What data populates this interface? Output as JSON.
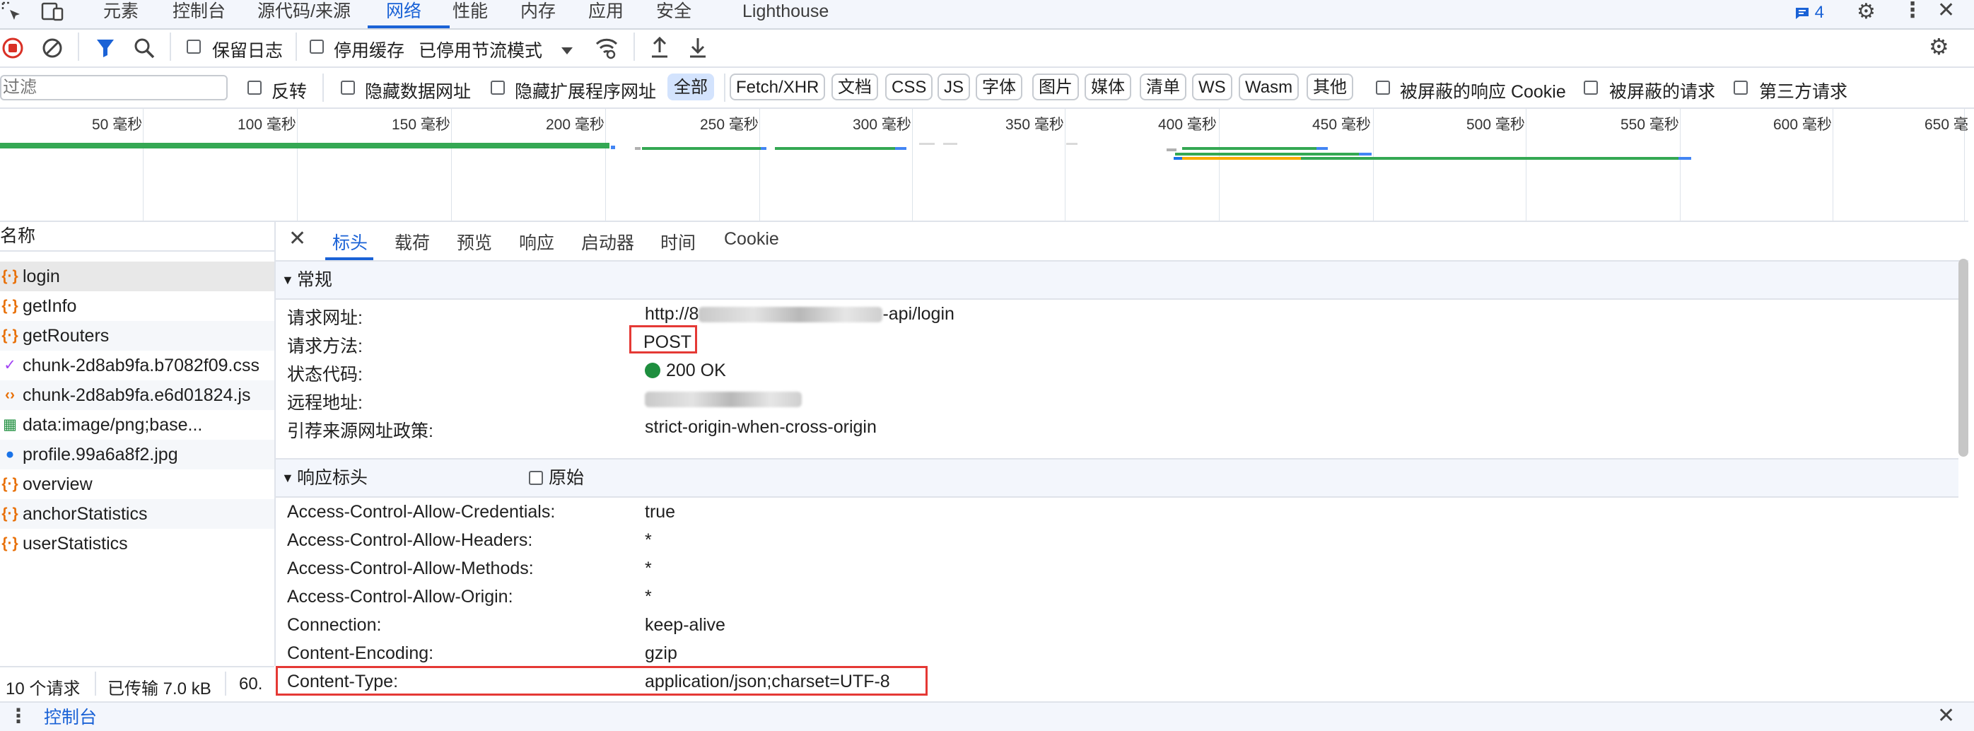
{
  "top_tabs": {
    "elements": "元素",
    "console": "控制台",
    "sources": "源代码/来源",
    "network": "网络",
    "performance": "性能",
    "memory": "内存",
    "application": "应用",
    "security": "安全",
    "lighthouse": "Lighthouse",
    "issues_count": "4"
  },
  "toolbar": {
    "preserve_log": "保留日志",
    "disable_cache": "停用缓存",
    "throttling": "已停用节流模式"
  },
  "filterbar": {
    "filter_placeholder": "过滤",
    "invert": "反转",
    "hide_data_urls": "隐藏数据网址",
    "hide_extension_urls": "隐藏扩展程序网址",
    "chips": [
      "全部",
      "Fetch/XHR",
      "文档",
      "CSS",
      "JS",
      "字体",
      "图片",
      "媒体",
      "清单",
      "WS",
      "Wasm",
      "其他"
    ],
    "blocked_cookies": "被屏蔽的响应 Cookie",
    "blocked_requests": "被屏蔽的请求",
    "third_party": "第三方请求"
  },
  "timeline": {
    "ticks": [
      "50 毫秒",
      "100 毫秒",
      "150 毫秒",
      "200 毫秒",
      "250 毫秒",
      "300 毫秒",
      "350 毫秒",
      "400 毫秒",
      "450 毫秒",
      "500 毫秒",
      "550 毫秒",
      "600 毫秒",
      "650 毫"
    ]
  },
  "requests": {
    "header": "名称",
    "items": [
      {
        "name": "login",
        "icon": "{·}",
        "icon_color": "#e8710a"
      },
      {
        "name": "getInfo",
        "icon": "{·}",
        "icon_color": "#e8710a"
      },
      {
        "name": "getRouters",
        "icon": "{·}",
        "icon_color": "#e8710a"
      },
      {
        "name": "chunk-2d8ab9fa.b7082f09.css",
        "icon": "✓",
        "icon_color": "#a142f4"
      },
      {
        "name": "chunk-2d8ab9fa.e6d01824.js",
        "icon": "‹›",
        "icon_color": "#e8710a"
      },
      {
        "name": "data:image/png;base...",
        "icon": "▦",
        "icon_color": "#1e8e3e"
      },
      {
        "name": "profile.99a6a8f2.jpg",
        "icon": "●",
        "icon_color": "#1a73e8"
      },
      {
        "name": "overview",
        "icon": "{·}",
        "icon_color": "#e8710a"
      },
      {
        "name": "anchorStatistics",
        "icon": "{·}",
        "icon_color": "#e8710a"
      },
      {
        "name": "userStatistics",
        "icon": "{·}",
        "icon_color": "#e8710a"
      }
    ]
  },
  "status": {
    "requests": "10 个请求",
    "transferred": "已传输 7.0 kB",
    "resources": "60."
  },
  "detail_tabs": [
    "标头",
    "载荷",
    "预览",
    "响应",
    "启动器",
    "时间",
    "Cookie"
  ],
  "general": {
    "title": "常规",
    "rows": [
      {
        "key": "请求网址:",
        "value_prefix": "http://8",
        "value_suffix": "-api/login"
      },
      {
        "key": "请求方法:",
        "value": "POST"
      },
      {
        "key": "状态代码:",
        "value": "200 OK"
      },
      {
        "key": "远程地址:",
        "value": ""
      },
      {
        "key": "引荐来源网址政策:",
        "value": "strict-origin-when-cross-origin"
      }
    ]
  },
  "response_headers": {
    "title": "响应标头",
    "raw_label": "原始",
    "rows": [
      {
        "key": "Access-Control-Allow-Credentials:",
        "value": "true"
      },
      {
        "key": "Access-Control-Allow-Headers:",
        "value": "*"
      },
      {
        "key": "Access-Control-Allow-Methods:",
        "value": "*"
      },
      {
        "key": "Access-Control-Allow-Origin:",
        "value": "*"
      },
      {
        "key": "Connection:",
        "value": "keep-alive"
      },
      {
        "key": "Content-Encoding:",
        "value": "gzip"
      },
      {
        "key": "Content-Type:",
        "value": "application/json;charset=UTF-8"
      }
    ]
  },
  "drawer": {
    "console_tab": "控制台"
  },
  "colors": {
    "accent": "#1a62d6",
    "highlight_box": "#e53935",
    "status_ok": "#1e8e3e"
  }
}
